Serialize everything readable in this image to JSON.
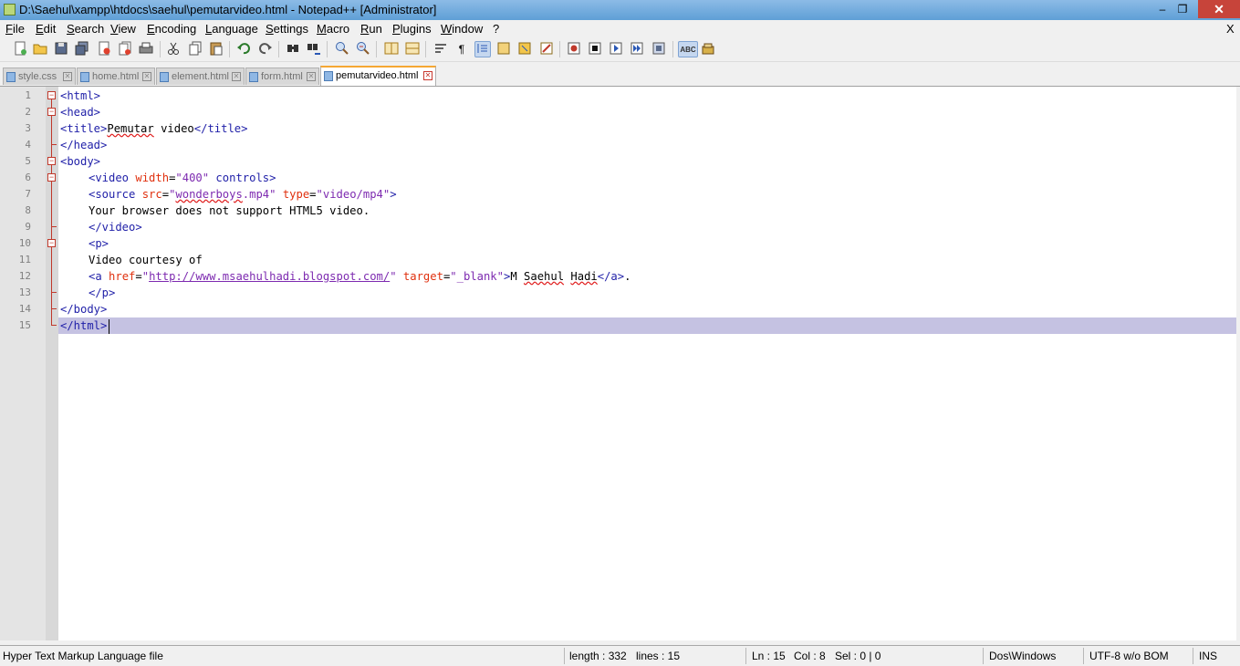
{
  "window": {
    "title": "D:\\Saehul\\xampp\\htdocs\\saehul\\pemutarvideo.html - Notepad++ [Administrator]",
    "minimize": "–",
    "maximize": "❐",
    "close": "✕"
  },
  "menu": [
    "File",
    "Edit",
    "Search",
    "View",
    "Encoding",
    "Language",
    "Settings",
    "Macro",
    "Run",
    "Plugins",
    "Window",
    "?"
  ],
  "menu_close_doc": "X",
  "toolbar_icons": [
    "new-file-icon",
    "open-file-icon",
    "save-icon",
    "save-all-icon",
    "close-icon",
    "close-all-icon",
    "print-icon",
    "cut-icon",
    "copy-icon",
    "paste-icon",
    "undo-icon",
    "redo-icon",
    "find-icon",
    "replace-icon",
    "zoom-in-icon",
    "zoom-out-icon",
    "sync-vertical-icon",
    "sync-horizontal-icon",
    "word-wrap-icon",
    "show-all-chars-icon",
    "indent-guide-icon",
    "doc-map-icon",
    "function-list-icon",
    "folder-workspace-icon",
    "record-macro-icon",
    "stop-record-icon",
    "play-macro-icon",
    "run-macro-multiple-icon",
    "save-macro-icon",
    "spell-check-icon",
    "plugin-icon"
  ],
  "tabs": [
    {
      "label": "style.css",
      "active": false
    },
    {
      "label": "home.html",
      "active": false
    },
    {
      "label": "element.html",
      "active": false
    },
    {
      "label": "form.html",
      "active": false
    },
    {
      "label": "pemutarvideo.html",
      "active": true
    }
  ],
  "line_numbers": [
    "1",
    "2",
    "3",
    "4",
    "5",
    "6",
    "7",
    "8",
    "9",
    "10",
    "11",
    "12",
    "13",
    "14",
    "15"
  ],
  "code": {
    "l1": "<html>",
    "l2": "<head>",
    "l3_open": "<title>",
    "l3_word": "Pemutar",
    "l3_text": " video",
    "l3_close": "</title>",
    "l4": "</head>",
    "l5": "<body>",
    "l6_open": "<video",
    "l6_attr": " width",
    "l6_eq": "=",
    "l6_val": "\"400\"",
    "l6_rest": " controls>",
    "l7_open": "<source",
    "l7_attr1": " src",
    "l7_eq1": "=",
    "l7_q1": "\"",
    "l7_val1w": "wonderboys",
    "l7_val1r": ".mp4\"",
    "l7_attr2": " type",
    "l7_eq2": "=",
    "l7_val2": "\"video/mp4\"",
    "l7_close": ">",
    "l8": "Your browser does not support HTML5 video.",
    "l9": "</video>",
    "l10": "<p>",
    "l11": "Video courtesy of",
    "l12_open": "<a",
    "l12_attr1": " href",
    "l12_eq1": "=",
    "l12_q1": "\"",
    "l12_url": "http://www.msaehulhadi.blogspot.com/",
    "l12_q2": "\"",
    "l12_attr2": " target",
    "l12_eq2": "=",
    "l12_val2": "\"_blank\"",
    "l12_gt": ">",
    "l12_t1": "M ",
    "l12_w1": "Saehul",
    "l12_sp": " ",
    "l12_w2": "Hadi",
    "l12_close": "</a>",
    "l12_dot": ".",
    "l13": "</p>",
    "l14": "</body>",
    "l15": "</html>"
  },
  "status": {
    "filetype": "Hyper Text Markup Language file",
    "length": "length : 332",
    "lines": "lines : 15",
    "ln": "Ln : 15",
    "col": "Col : 8",
    "sel": "Sel : 0 | 0",
    "eol": "Dos\\Windows",
    "encoding": "UTF-8 w/o BOM",
    "mode": "INS"
  },
  "colors": {
    "tag": "#1f1fa8",
    "attribute": "#e0300e",
    "string": "#7d2ab0",
    "current_line": "#c5c2e2",
    "active_tab_accent": "#f5a733"
  }
}
